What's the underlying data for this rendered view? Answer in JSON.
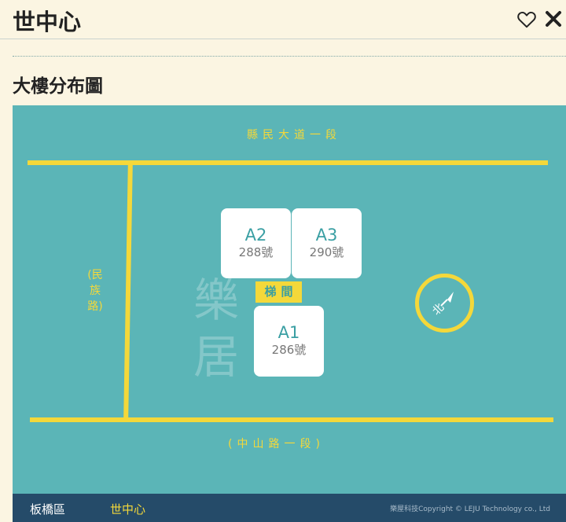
{
  "header": {
    "title": "世中心",
    "heart_icon": "heart-icon",
    "close_icon": "close-icon"
  },
  "section": {
    "title": "大樓分布圖"
  },
  "map": {
    "roads": {
      "top": "縣民大道一段",
      "left": "(民族路)",
      "bottom": "(中山路一段)"
    },
    "buildings": [
      {
        "code": "A2",
        "number": "288號"
      },
      {
        "code": "A3",
        "number": "290號"
      },
      {
        "code": "A1",
        "number": "286號"
      }
    ],
    "stairwell": "梯間",
    "watermark": "樂居",
    "compass_label": "北",
    "colors": {
      "map_bg": "#5bb5b7",
      "road": "#f4d83a",
      "building_text": "#3a9fa3"
    }
  },
  "footer": {
    "crumbs": [
      "板橋區",
      "世中心"
    ],
    "copyright": "樂屋科技Copyright © LEJU Technology co., Ltd"
  }
}
